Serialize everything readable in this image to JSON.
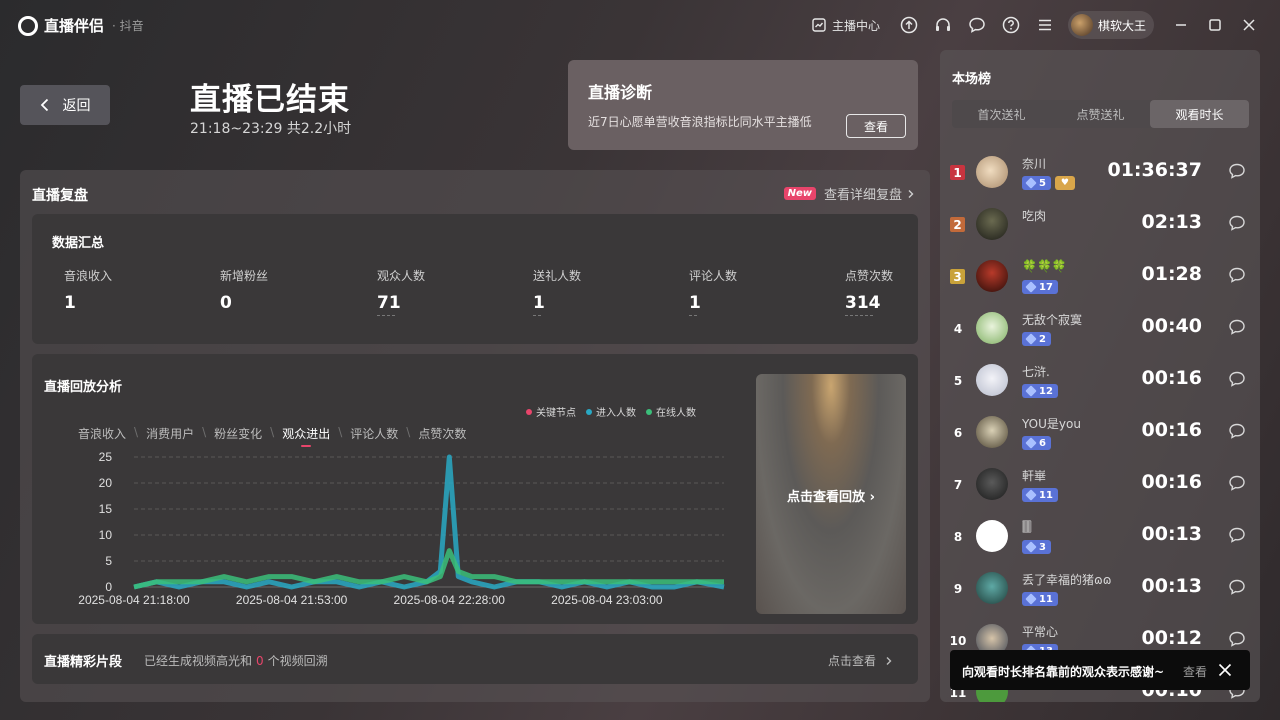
{
  "app": {
    "logo_text": "直播伴侣",
    "platform": "· 抖音"
  },
  "titlebar": {
    "anchor_center": "主播中心",
    "username": "棋软大王"
  },
  "header": {
    "back_label": "返回",
    "title": "直播已结束",
    "time_range": "21:18~23:29 共2.2小时"
  },
  "diagnosis": {
    "title": "直播诊断",
    "desc": "近7日心愿单营收音浪指标比同水平主播低",
    "button": "查看"
  },
  "review": {
    "title": "直播复盘",
    "new_badge": "New",
    "detail_link": "查看详细复盘"
  },
  "summary": {
    "title": "数据汇总",
    "metrics": [
      {
        "label": "音浪收入",
        "value": "1"
      },
      {
        "label": "新增粉丝",
        "value": "0"
      },
      {
        "label": "观众人数",
        "value": "71"
      },
      {
        "label": "送礼人数",
        "value": "1"
      },
      {
        "label": "评论人数",
        "value": "1"
      },
      {
        "label": "点赞次数",
        "value": "314"
      }
    ]
  },
  "analysis": {
    "title": "直播回放分析",
    "legend": [
      "关键节点",
      "进入人数",
      "在线人数"
    ],
    "tabs": [
      "音浪收入",
      "消费用户",
      "粉丝变化",
      "观众进出",
      "评论人数",
      "点赞次数"
    ],
    "active_tab": "观众进出",
    "replay_label": "点击查看回放"
  },
  "chart_data": {
    "type": "line",
    "x": [
      "2025-08-04 21:18:00",
      "2025-08-04 21:23:00",
      "2025-08-04 21:28:00",
      "2025-08-04 21:33:00",
      "2025-08-04 21:38:00",
      "2025-08-04 21:43:00",
      "2025-08-04 21:48:00",
      "2025-08-04 21:53:00",
      "2025-08-04 21:58:00",
      "2025-08-04 22:03:00",
      "2025-08-04 22:08:00",
      "2025-08-04 22:13:00",
      "2025-08-04 22:18:00",
      "2025-08-04 22:23:00",
      "2025-08-04 22:26:00",
      "2025-08-04 22:28:00",
      "2025-08-04 22:30:00",
      "2025-08-04 22:33:00",
      "2025-08-04 22:38:00",
      "2025-08-04 22:43:00",
      "2025-08-04 22:48:00",
      "2025-08-04 22:53:00",
      "2025-08-04 22:58:00",
      "2025-08-04 23:03:00",
      "2025-08-04 23:08:00",
      "2025-08-04 23:13:00",
      "2025-08-04 23:18:00",
      "2025-08-04 23:23:00",
      "2025-08-04 23:29:00"
    ],
    "xticks": [
      "2025-08-04 21:18:00",
      "2025-08-04 21:53:00",
      "2025-08-04 22:28:00",
      "2025-08-04 23:03:00"
    ],
    "series": [
      {
        "name": "进入人数",
        "color": "#29a9c4",
        "values": [
          0,
          1,
          0,
          1,
          1,
          0,
          1,
          0,
          1,
          1,
          0,
          1,
          0,
          1,
          3,
          25,
          2,
          1,
          0,
          1,
          1,
          0,
          1,
          0,
          1,
          0,
          0,
          1,
          0
        ]
      },
      {
        "name": "在线人数",
        "color": "#3bbf7a",
        "values": [
          0,
          1,
          1,
          1,
          2,
          1,
          2,
          2,
          1,
          2,
          1,
          1,
          2,
          1,
          2,
          7,
          3,
          2,
          2,
          1,
          1,
          1,
          1,
          1,
          1,
          1,
          1,
          1,
          1
        ]
      }
    ],
    "yticks": [
      0,
      5,
      10,
      15,
      20,
      25
    ],
    "ylim": [
      0,
      25
    ],
    "grid": true,
    "legend_position": "top-right"
  },
  "clips": {
    "title": "直播精彩片段",
    "desc_before": "已经生成视频高光和",
    "count": "0",
    "desc_after": "个视频回溯",
    "link": "点击查看"
  },
  "board": {
    "title": "本场榜",
    "tabs": [
      "首次送礼",
      "点赞送礼",
      "观看时长"
    ],
    "active_tab": "观看时长",
    "rows": [
      {
        "rank": "1",
        "name": "奈川",
        "level": "5",
        "time": "01:36:37"
      },
      {
        "rank": "2",
        "name": "吃肉",
        "level": "",
        "time": "02:13"
      },
      {
        "rank": "3",
        "name": "🍀🍀🍀",
        "level": "17",
        "time": "01:28"
      },
      {
        "rank": "4",
        "name": "无敌个寂寞",
        "level": "2",
        "time": "00:40"
      },
      {
        "rank": "5",
        "name": "七浒.",
        "level": "12",
        "time": "00:16"
      },
      {
        "rank": "6",
        "name": "YOU是you",
        "level": "6",
        "time": "00:16"
      },
      {
        "rank": "7",
        "name": "軒崋",
        "level": "11",
        "time": "00:16"
      },
      {
        "rank": "8",
        "name": "🀫",
        "level": "3",
        "time": "00:13"
      },
      {
        "rank": "9",
        "name": "丢了幸福的猪ɷɷ",
        "level": "11",
        "time": "00:13"
      },
      {
        "rank": "10",
        "name": "平常心",
        "level": "13",
        "time": "00:12"
      },
      {
        "rank": "11",
        "name": "",
        "level": "",
        "time": "00:10"
      }
    ]
  },
  "toast": {
    "text": "向观看时长排名靠前的观众表示感谢~",
    "view": "查看"
  }
}
